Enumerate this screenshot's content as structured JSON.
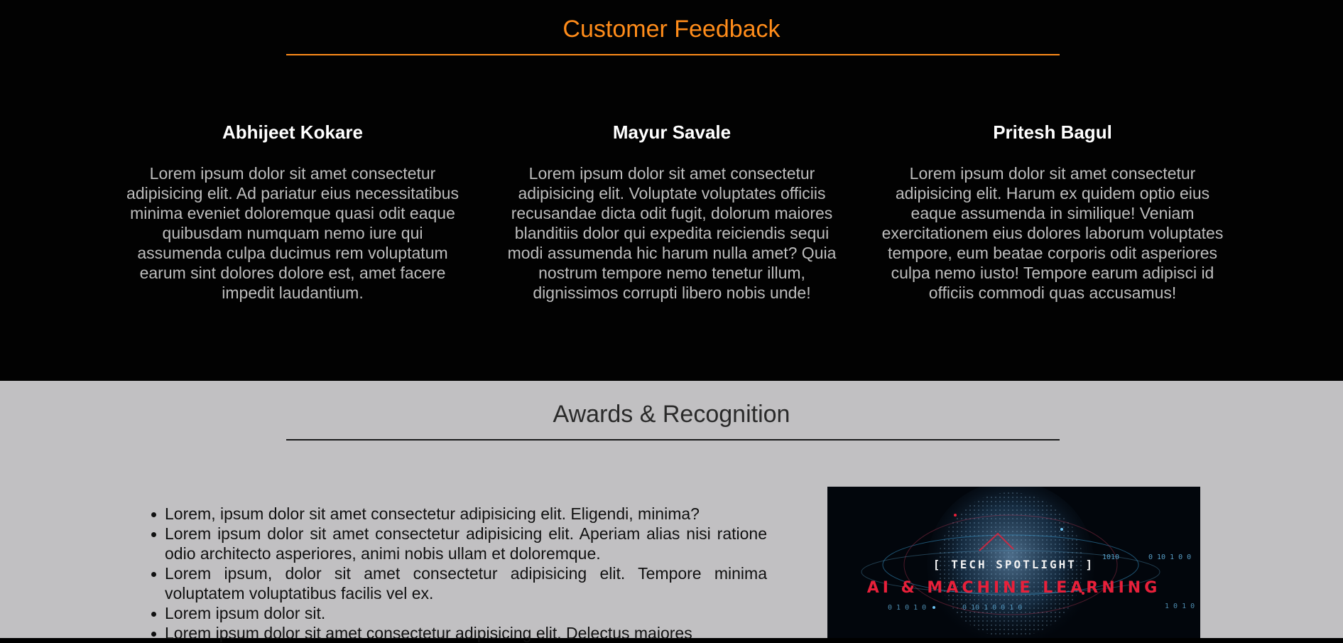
{
  "feedback": {
    "title": "Customer Feedback",
    "reviews": [
      {
        "name": "Abhijeet Kokare",
        "text": "Lorem ipsum dolor sit amet consectetur adipisicing elit. Ad pariatur eius necessitatibus minima eveniet doloremque quasi odit eaque quibusdam numquam nemo iure qui assumenda culpa ducimus rem voluptatum earum sint dolores dolore est, amet facere impedit laudantium."
      },
      {
        "name": "Mayur Savale",
        "text": "Lorem ipsum dolor sit amet consectetur adipisicing elit. Voluptate voluptates officiis recusandae dicta odit fugit, dolorum maiores blanditiis dolor qui expedita reiciendis sequi modi assumenda hic harum nulla amet? Quia nostrum tempore nemo tenetur illum, dignissimos corrupti libero nobis unde!"
      },
      {
        "name": "Pritesh Bagul",
        "text": "Lorem ipsum dolor sit amet consectetur adipisicing elit. Harum ex quidem optio eius eaque assumenda in similique! Veniam exercitationem eius dolores laborum voluptates tempore, eum beatae corporis odit asperiores culpa nemo iusto! Tempore earum adipisci id officiis commodi quas accusamus!"
      }
    ]
  },
  "awards": {
    "title": "Awards & Recognition",
    "items": [
      "Lorem, ipsum dolor sit amet consectetur adipisicing elit. Eligendi, minima?",
      "Lorem ipsum dolor sit amet consectetur adipisicing elit. Aperiam alias nisi ratione odio architecto asperiores, animi nobis ullam et doloremque.",
      "Lorem ipsum, dolor sit amet consectetur adipisicing elit. Tempore minima voluptatem voluptatibus facilis vel ex.",
      "Lorem ipsum dolor sit.",
      "Lorem ipsum dolor sit amet consectetur adipisicing elit. Delectus maiores"
    ],
    "image": {
      "kicker": "[ TECH SPOTLIGHT ]",
      "title": "AI & MACHINE LEARNING",
      "binary": [
        "1010",
        "0 10 1 0 0",
        "0 1 0 1 0",
        "0 10 1 0 0 1 0",
        "1 0 1 0"
      ]
    }
  },
  "colors": {
    "feedback_bg": "#020202",
    "accent": "#ff8c1a",
    "awards_bg": "#c1c0c2",
    "spotlight_red": "#e8203a"
  }
}
